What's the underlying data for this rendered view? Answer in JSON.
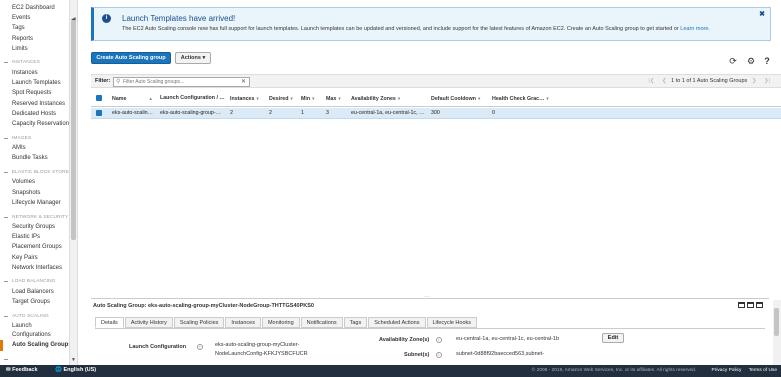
{
  "sidebar": {
    "top_items": [
      "EC2 Dashboard",
      "Events",
      "Tags",
      "Reports",
      "Limits"
    ],
    "sections": [
      {
        "title": "INSTANCES",
        "items": [
          "Instances",
          "Launch Templates",
          "Spot Requests",
          "Reserved Instances",
          "Dedicated Hosts",
          "Capacity Reservations"
        ]
      },
      {
        "title": "IMAGES",
        "items": [
          "AMIs",
          "Bundle Tasks"
        ]
      },
      {
        "title": "ELASTIC BLOCK STORE",
        "items": [
          "Volumes",
          "Snapshots",
          "Lifecycle Manager"
        ]
      },
      {
        "title": "NETWORK & SECURITY",
        "items": [
          "Security Groups",
          "Elastic IPs",
          "Placement Groups",
          "Key Pairs",
          "Network Interfaces"
        ]
      },
      {
        "title": "LOAD BALANCING",
        "items": [
          "Load Balancers",
          "Target Groups"
        ]
      },
      {
        "title": "AUTO SCALING",
        "items": [
          "Launch Configurations",
          "Auto Scaling Groups"
        ]
      }
    ],
    "active_item": "Auto Scaling Groups"
  },
  "banner": {
    "title": "Launch Templates have arrived!",
    "text": "The EC2 Auto Scaling console now has full support for launch templates. Launch templates can be updated and versioned, and include support for the latest features of Amazon EC2. Create an Auto Scaling group to get started or",
    "link": "Learn more."
  },
  "toolbar": {
    "create_label": "Create Auto Scaling group",
    "actions_label": "Actions"
  },
  "filter": {
    "label": "Filter:",
    "placeholder": "Filter Auto Scaling groups...",
    "pager_text": "1 to 1 of 1 Auto Scaling Groups"
  },
  "grid": {
    "columns": [
      "Name",
      "Launch Configuration / …",
      "Instances",
      "Desired",
      "Min",
      "Max",
      "Availability Zones",
      "Default Cooldown",
      "Health Check Grac…"
    ],
    "row": [
      "eks-auto-scalin…",
      "eks-auto-scaling-group-…",
      "2",
      "2",
      "1",
      "3",
      "eu-central-1a, eu-central-1c, …",
      "300",
      "0"
    ]
  },
  "detail": {
    "title": "Auto Scaling Group: eks-auto-scaling-group-myCluster-NodeGroup-THTTGS40PKS0",
    "tabs": [
      "Details",
      "Activity History",
      "Scaling Policies",
      "Instances",
      "Monitoring",
      "Notifications",
      "Tags",
      "Scheduled Actions",
      "Lifecycle Hooks"
    ],
    "launch_config_label": "Launch Configuration",
    "launch_config_value": "eks-auto-scaling-group-myCluster-NodeLaunchConfig-KFKJYSBCFUCR",
    "az_label": "Availability Zone(s)",
    "az_value": "eu-central-1a, eu-central-1c, eu-central-1b",
    "subnet_label": "Subnet(s)",
    "subnet_value": "subnet-0d88f92baecced563,subnet-",
    "edit_label": "Edit"
  },
  "footer": {
    "feedback": "Feedback",
    "language": "English (US)",
    "copyright": "© 2008 - 2019, Amazon Web Services, Inc. or its affiliates. All rights reserved.",
    "privacy": "Privacy Policy",
    "terms": "Terms of Use"
  },
  "colors": {
    "primary": "#1b75bc",
    "footer_bg": "#232f3e",
    "active_accent": "#e07b00",
    "selected_row": "#dbeaf7"
  }
}
